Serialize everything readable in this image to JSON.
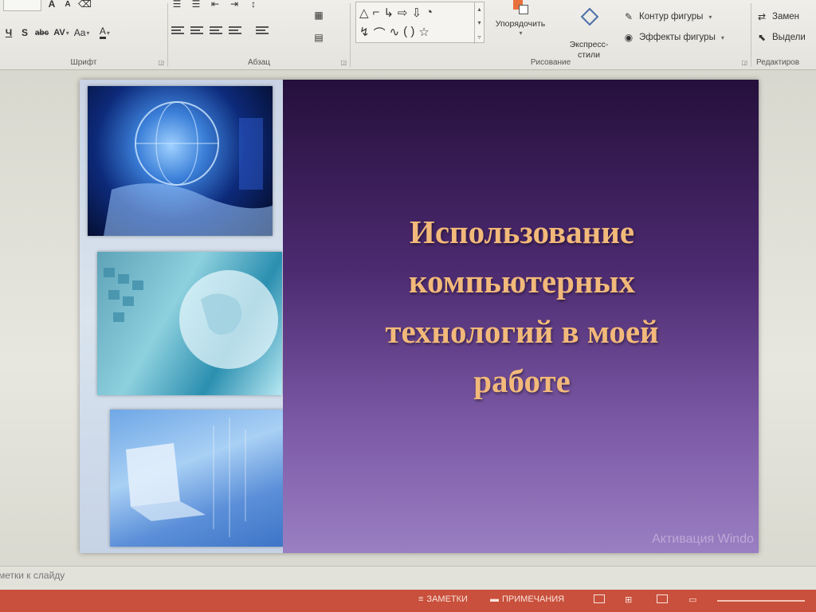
{
  "ribbon": {
    "font_group": {
      "label": "Шрифт",
      "strike_label": "abc",
      "spacing_label": "AV",
      "case_label": "Aa",
      "color_label": "A"
    },
    "paragraph_group": {
      "label": "Абзац"
    },
    "drawing_group": {
      "label": "Рисование",
      "arrange_label": "Упорядочить",
      "quick_styles_label": "Экспресс-\nстили",
      "shape_outline_label": "Контур фигуры",
      "shape_effects_label": "Эффекты фигуры"
    },
    "editing_group": {
      "label": "Редактиров",
      "replace_label": "Замен",
      "select_label": "Выдели"
    }
  },
  "slide": {
    "title": "Использование компьютерных технологий в моей работе",
    "watermark": "Активация Windo"
  },
  "notes": {
    "placeholder": "метки к слайду"
  },
  "status_bar": {
    "notes_label": "ЗАМЕТКИ",
    "comments_label": "ПРИМЕЧАНИЯ"
  },
  "colors": {
    "status_bar": "#c8503c",
    "title_text": "#f2b97a",
    "slide_background": "#4c2a70"
  }
}
